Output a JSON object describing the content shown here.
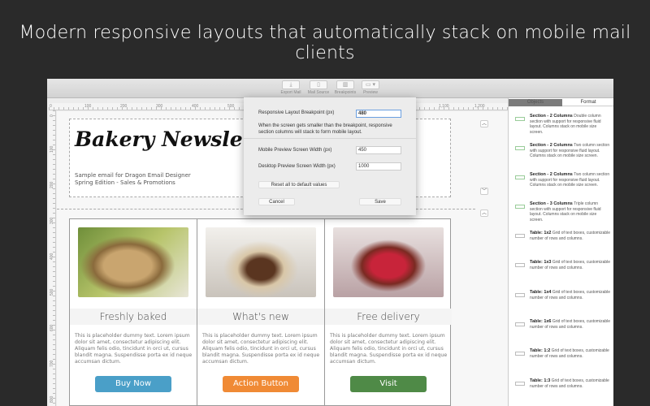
{
  "headline": "Modern responsive layouts that automatically stack on mobile mail clients",
  "toolbar": {
    "items": [
      {
        "label": "Export Mail",
        "icon": "export-icon"
      },
      {
        "label": "Mail Source",
        "icon": "document-icon"
      },
      {
        "label": "Breakpoints",
        "icon": "columns-icon"
      },
      {
        "label": "Preview",
        "icon": "monitor-icon"
      }
    ]
  },
  "ruler": {
    "top": [
      "0",
      "100",
      "200",
      "300",
      "400",
      "500",
      "1,100",
      "1,200"
    ],
    "left": [
      "0",
      "100",
      "200",
      "300",
      "400",
      "500",
      "600",
      "700",
      "800"
    ]
  },
  "email": {
    "title": "Bakery Newsletter",
    "subtitle1": "Sample email for Dragon Email Designer",
    "subtitle2": "Spring Edition - Sales & Promotions",
    "columns": [
      {
        "heading": "Freshly baked",
        "text": "This is placeholder dummy text.  Lorem ipsum dolor sit amet, consectetur adipiscing elit. Aliquam felis odio, tincidunt in orci ut, cursus blandit magna. Suspendisse porta ex id neque accumsan dictum.",
        "button": "Buy Now",
        "color": "#4a9fc8"
      },
      {
        "heading": "What's new",
        "text": "This is placeholder dummy text.  Lorem ipsum dolor sit amet, consectetur adipiscing elit. Aliquam felis odio, tincidunt in orci ut, cursus blandit magna. Suspendisse porta ex id neque accumsan dictum.",
        "button": "Action Button",
        "color": "#f08a35"
      },
      {
        "heading": "Free delivery",
        "text": "This is placeholder dummy text.  Lorem ipsum dolor sit amet, consectetur adipiscing elit. Aliquam felis odio, tincidunt in orci ut, cursus blandit magna. Suspendisse porta ex id neque accumsan dictum.",
        "button": "Visit",
        "color": "#4f8a47"
      }
    ]
  },
  "dialog": {
    "breakpoint_label": "Responsive Layout Breakpoint (px)",
    "breakpoint_value": "480",
    "note": "When the screen gets smaller than the breakpoint, responsive section columns will stack to form mobile layout.",
    "mobile_label": "Mobile Preview Screen Width (px)",
    "mobile_value": "450",
    "desktop_label": "Desktop Preview Screen Width (px)",
    "desktop_value": "1000",
    "reset": "Reset all to default values",
    "cancel": "Cancel",
    "save": "Save"
  },
  "panel": {
    "tabs": [
      "Objects",
      "Format"
    ],
    "items": [
      {
        "title": "Section - 2 Columns",
        "desc": "Double column section with support for responsive fluid layout.  Columns stack on mobile size screen."
      },
      {
        "title": "Section - 2 Columns",
        "desc": "Two column section with support for responsive fluid layout.  Columns stack on mobile size screen."
      },
      {
        "title": "Section - 2 Columns",
        "desc": "Two column section with support for responsive fluid layout.  Columns stack on mobile size screen."
      },
      {
        "title": "Section - 3 Columns",
        "desc": "Triple column section with support for responsive fluid layout. Columns stack on mobile size screen."
      },
      {
        "title": "Table: 1x2",
        "desc": "Grid of text boxes, customizable number of rows and columns."
      },
      {
        "title": "Table: 1x3",
        "desc": "Grid of text boxes, customizable number of rows and columns."
      },
      {
        "title": "Table: 1x4",
        "desc": "Grid of text boxes, customizable number of rows and columns."
      },
      {
        "title": "Table: 1x6",
        "desc": "Grid of text boxes, customizable number of rows and columns."
      },
      {
        "title": "Table: 1:2",
        "desc": "Grid of text boxes, customizable number of rows and columns."
      },
      {
        "title": "Table: 1:3",
        "desc": "Grid of text boxes, customizable number of rows and columns."
      }
    ]
  }
}
